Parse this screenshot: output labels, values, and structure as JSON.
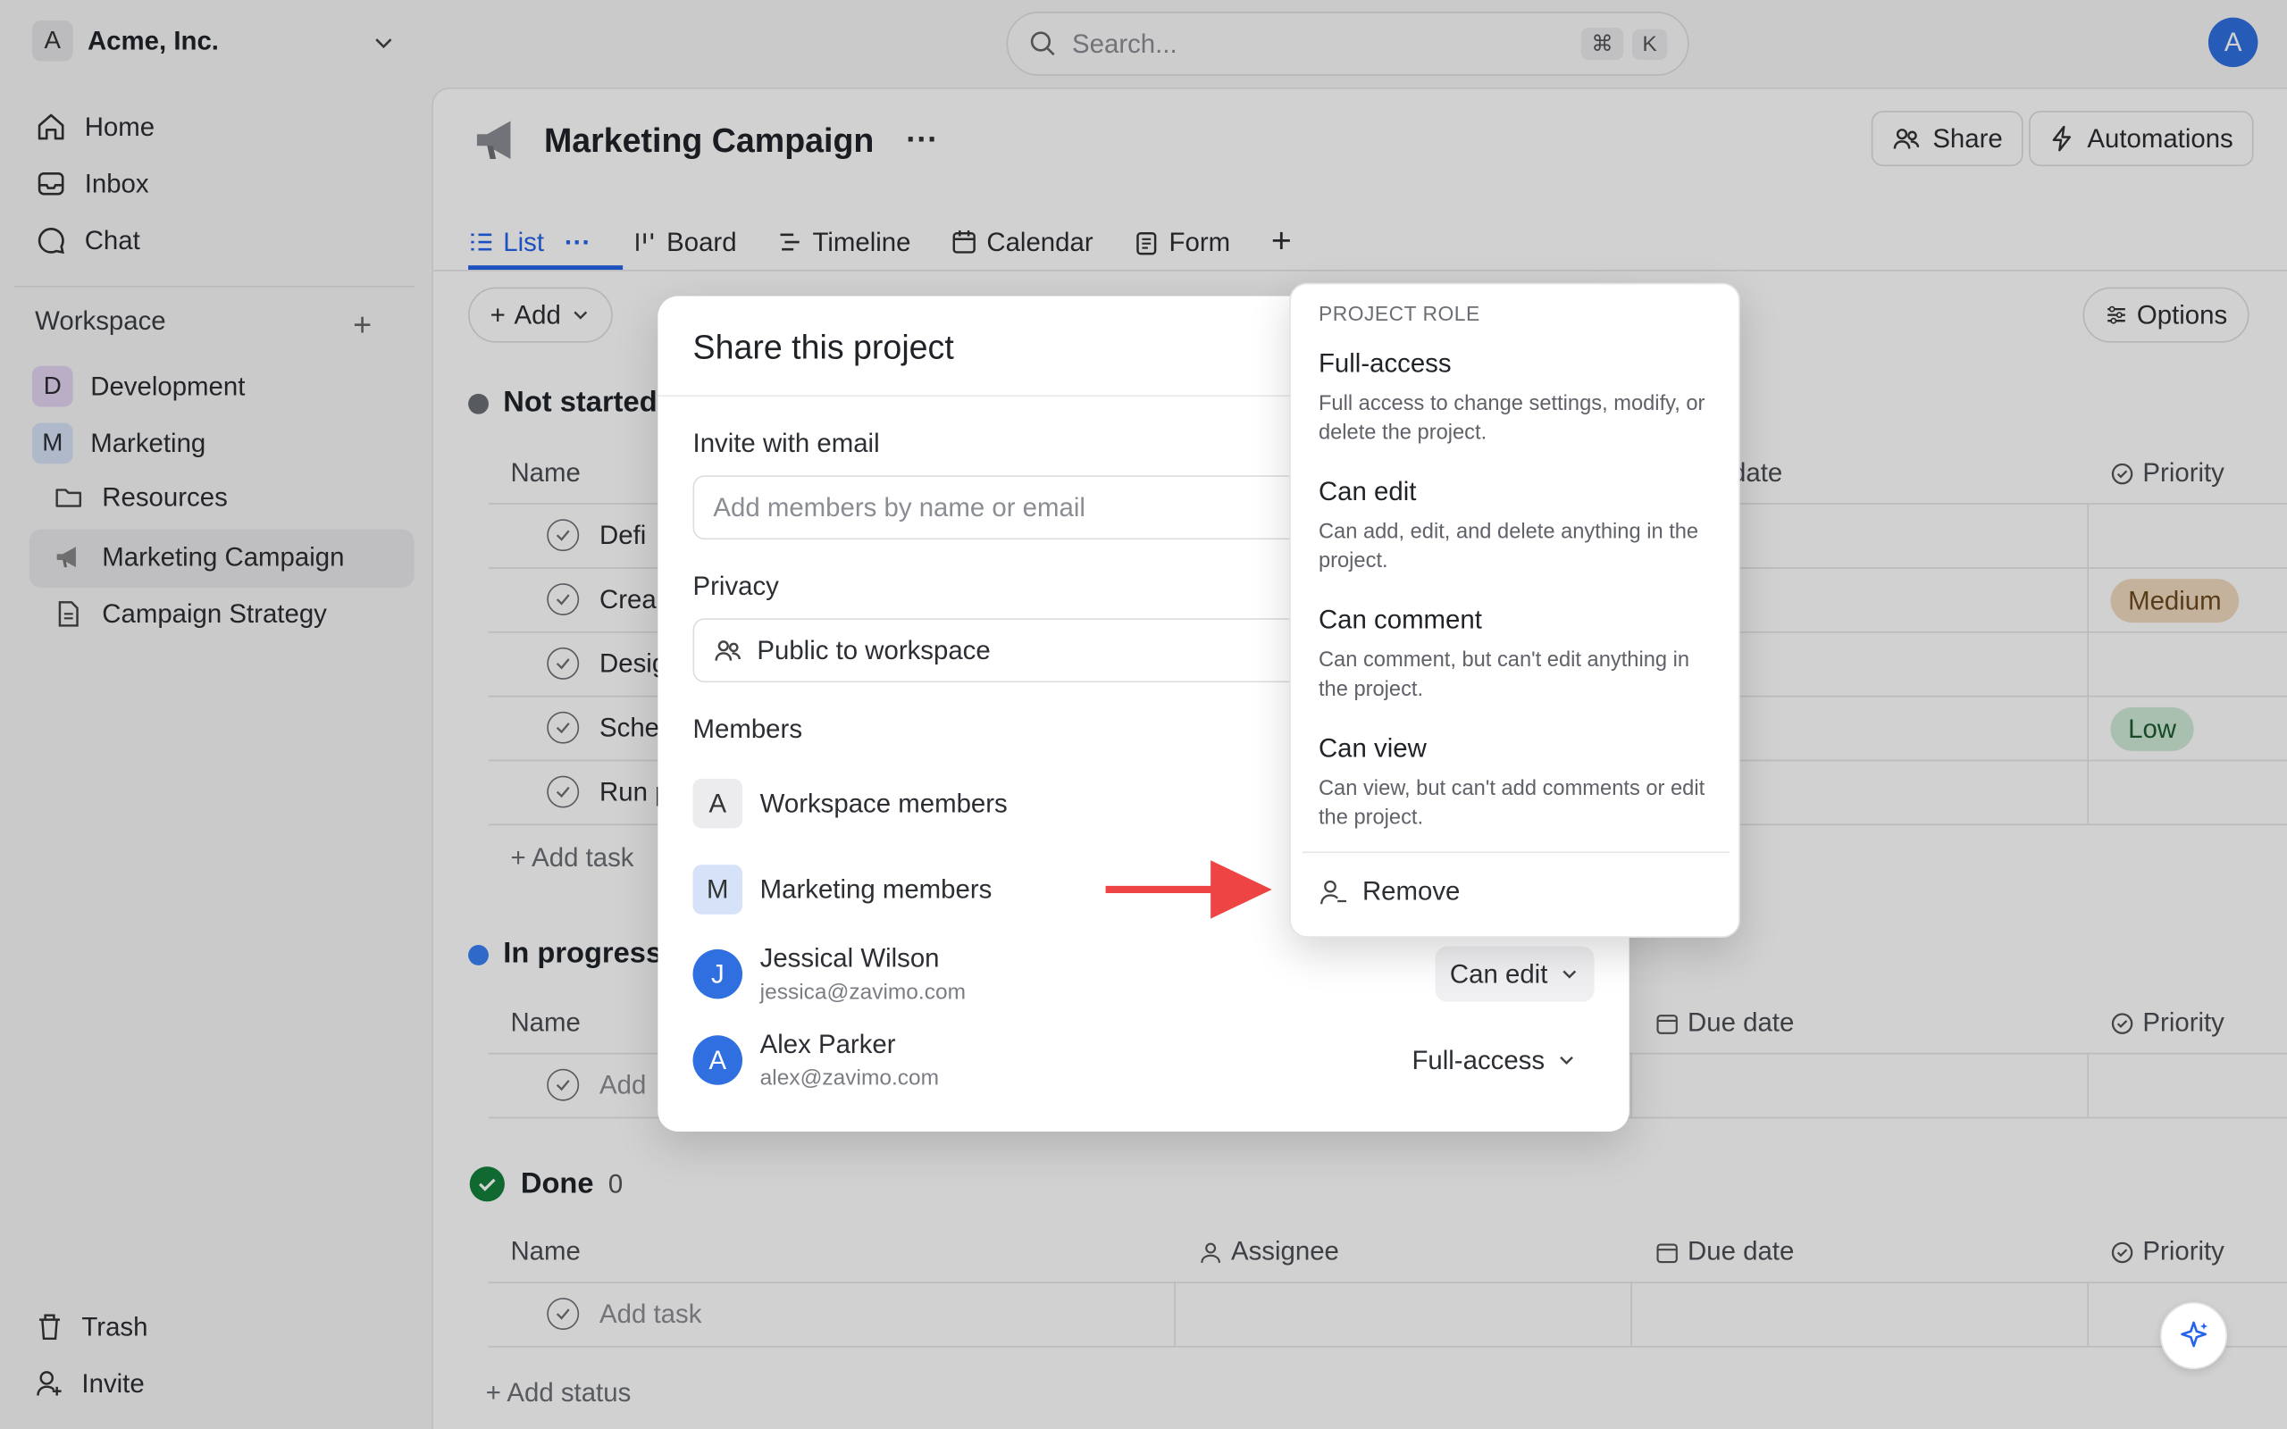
{
  "org": {
    "badge": "A",
    "name": "Acme, Inc."
  },
  "search": {
    "placeholder": "Search...",
    "shortcut_cmd": "⌘",
    "shortcut_key": "K"
  },
  "user_avatar": "A",
  "sidebar": {
    "nav": [
      "Home",
      "Inbox",
      "Chat"
    ],
    "workspace_label": "Workspace",
    "teams": [
      {
        "badge": "D",
        "label": "Development",
        "color": "#e3d5f3"
      },
      {
        "badge": "M",
        "label": "Marketing",
        "color": "#d6e2f7"
      }
    ],
    "items": [
      "Resources",
      "Marketing Campaign",
      "Campaign Strategy"
    ],
    "trash": "Trash",
    "invite": "Invite"
  },
  "project": {
    "title": "Marketing Campaign",
    "share_label": "Share",
    "automations_label": "Automations",
    "tabs": [
      "List",
      "Board",
      "Timeline",
      "Calendar",
      "Form"
    ],
    "add_label": "Add",
    "options_label": "Options"
  },
  "groups": {
    "not_started": {
      "title": "Not started",
      "color": "#6b6e74"
    },
    "in_progress": {
      "title": "In progress",
      "color": "#3b82f6"
    },
    "done": {
      "title": "Done",
      "count": "0",
      "color": "#15803d"
    }
  },
  "columns": {
    "name": "Name",
    "assignee": "Assignee",
    "due_date": "Due date",
    "due_date_partial": "date",
    "priority": "Priority"
  },
  "tasks_partial": [
    "Defi",
    "Crea",
    "Desig",
    "Sche",
    "Run p"
  ],
  "priorities": {
    "medium": "Medium",
    "low": "Low"
  },
  "add_task_link": "+ Add task",
  "add_task_row": "Add task",
  "add_task_partial": "Add",
  "add_status": "+ Add status",
  "dialog": {
    "title": "Share this project",
    "invite_label": "Invite with email",
    "invite_placeholder": "Add members by name or email",
    "privacy_label": "Privacy",
    "privacy_value": "Public to workspace",
    "members_label": "Members",
    "members": [
      {
        "badge": "A",
        "name": "Workspace members"
      },
      {
        "badge": "M",
        "name": "Marketing members"
      },
      {
        "badge": "J",
        "name": "Jessical Wilson",
        "email": "jessica@zavimo.com",
        "role": "Can edit"
      },
      {
        "badge": "A",
        "name": "Alex Parker",
        "email": "alex@zavimo.com",
        "role": "Full-access"
      }
    ]
  },
  "role_menu": {
    "header": "PROJECT ROLE",
    "options": [
      {
        "title": "Full-access",
        "desc": "Full access to change settings, modify, or delete the project."
      },
      {
        "title": "Can edit",
        "desc": "Can add, edit, and delete anything in the project."
      },
      {
        "title": "Can comment",
        "desc": "Can comment, but can't edit anything in the project."
      },
      {
        "title": "Can view",
        "desc": "Can view, but can't add comments or edit the project."
      }
    ],
    "remove_label": "Remove"
  },
  "colors": {
    "accent": "#2563eb",
    "arrow": "#ef4444",
    "medium_bg": "#f0d9bf",
    "low_bg": "#cfe9d6"
  }
}
